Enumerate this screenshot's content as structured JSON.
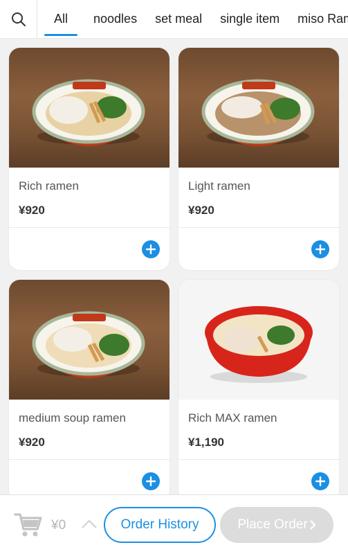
{
  "categories": [
    "All",
    "noodles",
    "set meal",
    "single item",
    "miso Ramen"
  ],
  "active_category": "All",
  "products": [
    {
      "name": "Rich ramen",
      "price": "¥920",
      "photo": "rich-ramen-bowl"
    },
    {
      "name": "Light ramen",
      "price": "¥920",
      "photo": "light-ramen-bowl"
    },
    {
      "name": "medium soup ramen",
      "price": "¥920",
      "photo": "medium-soup-ramen-bowl"
    },
    {
      "name": "Rich MAX ramen",
      "price": "¥1,190",
      "photo": "rich-max-ramen-bowl"
    }
  ],
  "cart": {
    "total": "¥0"
  },
  "buttons": {
    "order_history": "Order History",
    "place_order": "Place Order"
  },
  "colors": {
    "accent": "#1b8fe3",
    "disabled": "#dcdcdc"
  },
  "icons": [
    "search-icon",
    "plus-icon",
    "cart-icon",
    "chevron-up-icon",
    "chevron-right-icon"
  ]
}
